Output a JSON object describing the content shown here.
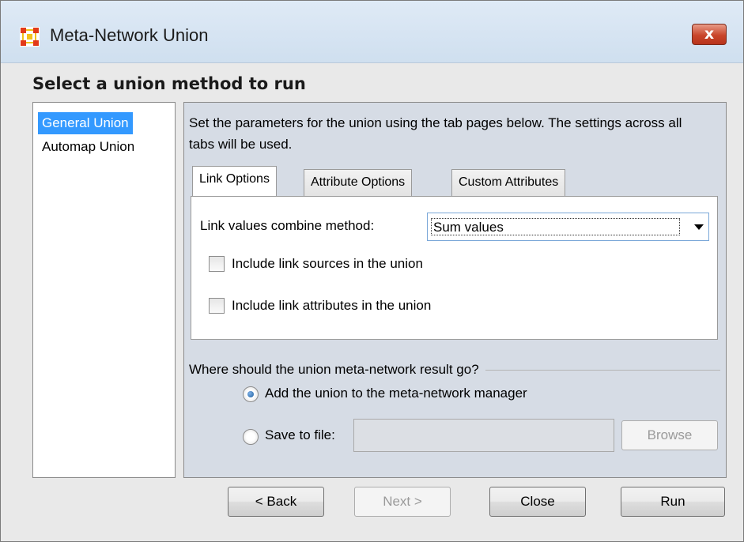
{
  "window": {
    "title": "Meta-Network Union",
    "close_label": "x"
  },
  "heading": "Select a union method to run",
  "methods": [
    {
      "label": "General Union",
      "selected": true
    },
    {
      "label": "Automap Union",
      "selected": false
    }
  ],
  "description": "Set the parameters for the union using the tab pages below. The settings across all tabs will be used.",
  "tabs": [
    {
      "label": "Link Options",
      "active": true
    },
    {
      "label": "Attribute Options",
      "active": false
    },
    {
      "label": "Custom Attributes",
      "active": false
    }
  ],
  "link_options": {
    "combine_label": "Link values combine method:",
    "combine_value": "Sum values",
    "include_sources_label": "Include link sources in the union",
    "include_sources_checked": false,
    "include_attributes_label": "Include link attributes in the union",
    "include_attributes_checked": false
  },
  "destination": {
    "group_label": "Where should the union meta-network result go?",
    "add_to_manager_label": "Add the union to the meta-network manager",
    "add_to_manager_selected": true,
    "save_to_file_label": "Save to file:",
    "save_to_file_selected": false,
    "file_path": "",
    "browse_label": "Browse"
  },
  "footer": {
    "back_label": "< Back",
    "next_label": "Next >",
    "close_label": "Close",
    "run_label": "Run"
  },
  "colors": {
    "selection": "#3399ff",
    "panel_bg": "#d6dce5",
    "close_button": "#c9452a"
  }
}
